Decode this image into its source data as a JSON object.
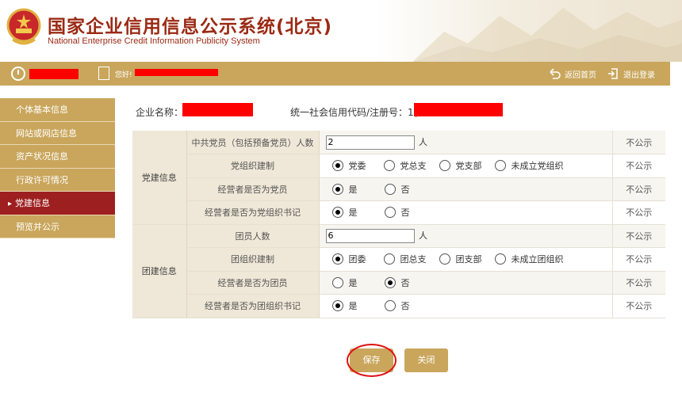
{
  "header": {
    "title_cn": "国家企业信用信息公示系统(北京)",
    "title_en": "National Enterprise Credit Information Publicity System"
  },
  "topbar": {
    "greeting": "您好!",
    "home_label": "返回首页",
    "logout_label": "退出登录"
  },
  "sidebar": {
    "items": [
      {
        "label": "个体基本信息",
        "active": false
      },
      {
        "label": "网站或网店信息",
        "active": false
      },
      {
        "label": "资产状况信息",
        "active": false
      },
      {
        "label": "行政许可情况",
        "active": false
      },
      {
        "label": "党建信息",
        "active": true
      },
      {
        "label": "预览并公示",
        "active": false
      }
    ]
  },
  "company": {
    "name_label": "企业名称：",
    "credit_label": "统一社会信用代码/注册号：1("
  },
  "party": {
    "group_label": "党建信息",
    "members": {
      "label": "中共党员（包括预备党员）人数",
      "value": "2",
      "unit": "人",
      "status": "不公示"
    },
    "org": {
      "label": "党组织建制",
      "options": [
        "党委",
        "党总支",
        "党支部",
        "未成立党组织"
      ],
      "selected": 0,
      "status": "不公示"
    },
    "operator_member": {
      "label": "经营者是否为党员",
      "options": [
        "是",
        "否"
      ],
      "selected": 0,
      "status": "不公示"
    },
    "operator_secretary": {
      "label": "经营者是否为党组织书记",
      "options": [
        "是",
        "否"
      ],
      "selected": 0,
      "status": "不公示"
    }
  },
  "league": {
    "group_label": "团建信息",
    "members": {
      "label": "团员人数",
      "value": "6",
      "unit": "人",
      "status": "不公示"
    },
    "org": {
      "label": "团组织建制",
      "options": [
        "团委",
        "团总支",
        "团支部",
        "未成立团组织"
      ],
      "selected": 0,
      "status": "不公示"
    },
    "operator_member": {
      "label": "经营者是否为团员",
      "options": [
        "是",
        "否"
      ],
      "selected": 1,
      "status": "不公示"
    },
    "operator_secretary": {
      "label": "经营者是否为团组织书记",
      "options": [
        "是",
        "否"
      ],
      "selected": 0,
      "status": "不公示"
    }
  },
  "buttons": {
    "save": "保存",
    "close": "关闭"
  },
  "colors": {
    "gold": "#c9a65c",
    "active_red": "#9e1f1f",
    "title_red": "#9b2a14",
    "redaction": "#ff0000"
  }
}
